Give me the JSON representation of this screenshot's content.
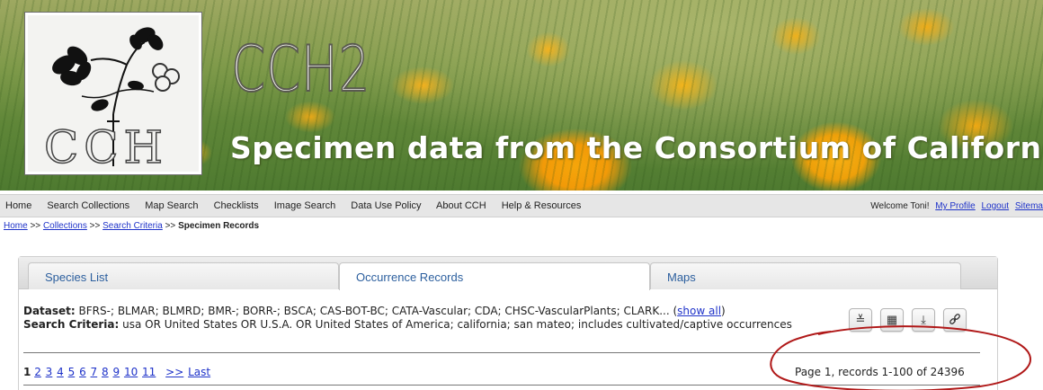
{
  "banner": {
    "logo_text": "CCH",
    "title": "CCH2",
    "subtitle": "Specimen data from the Consortium of California Herbaria"
  },
  "nav": {
    "items": [
      {
        "label": "Home"
      },
      {
        "label": "Search Collections"
      },
      {
        "label": "Map Search"
      },
      {
        "label": "Checklists"
      },
      {
        "label": "Image Search"
      },
      {
        "label": "Data Use Policy"
      },
      {
        "label": "About CCH"
      },
      {
        "label": "Help & Resources"
      }
    ],
    "welcome": "Welcome Toni!",
    "my_profile": "My Profile",
    "logout": "Logout",
    "sitemap": "Sitema"
  },
  "breadcrumb": {
    "home": "Home",
    "sep": ">>",
    "collections": "Collections",
    "search_criteria": "Search Criteria",
    "current": "Specimen Records"
  },
  "tabs": [
    {
      "label": "Species List",
      "active": false
    },
    {
      "label": "Occurrence Records",
      "active": true
    },
    {
      "label": "Maps",
      "active": false
    }
  ],
  "info": {
    "dataset_label": "Dataset:",
    "dataset_value": "BFRS-; BLMAR; BLMRD; BMR-; BORR-; BSCA; CAS-BOT-BC; CATA-Vascular; CDA; CHSC-VascularPlants; CLARK...",
    "show_all": "show all",
    "criteria_label": "Search Criteria:",
    "criteria_value": "usa OR United States OR U.S.A. OR United States of America; california; san mateo; includes cultivated/captive occurrences"
  },
  "toolbar": {
    "icons": [
      "expand-icon",
      "table-icon",
      "download-icon",
      "link-icon"
    ],
    "glyphs": [
      "≚",
      "▦",
      "⤓",
      "🔗"
    ]
  },
  "pager": {
    "current": "1",
    "pages": [
      "2",
      "3",
      "4",
      "5",
      "6",
      "7",
      "8",
      "9",
      "10",
      "11"
    ],
    "next": ">>",
    "last": "Last",
    "summary": "Page 1, records 1-100 of 24396"
  },
  "colors": {
    "link": "#1f33c9",
    "tab_text": "#2c5f9e",
    "annotation": "#b01818"
  }
}
